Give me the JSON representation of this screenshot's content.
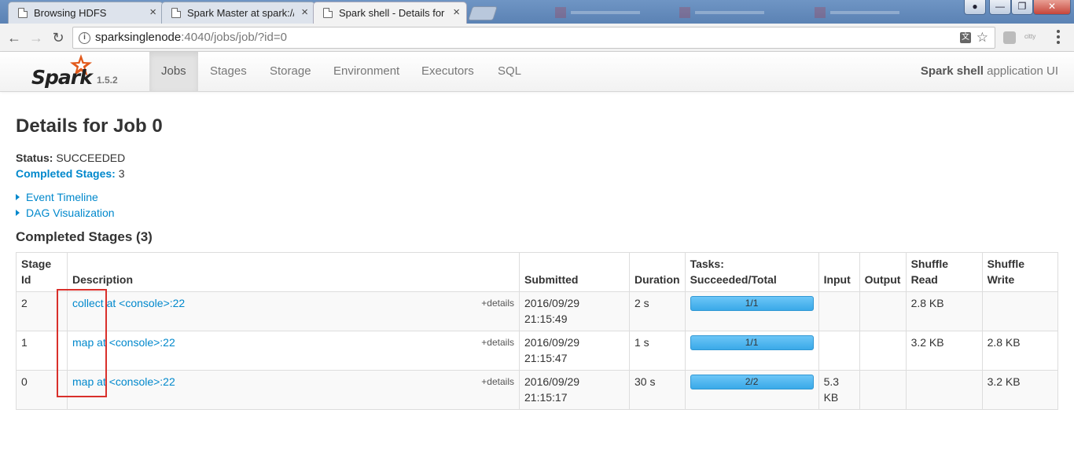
{
  "browser": {
    "tabs": [
      {
        "title": "Browsing HDFS"
      },
      {
        "title": "Spark Master at spark://"
      },
      {
        "title": "Spark shell - Details for"
      }
    ],
    "window_buttons": {
      "minimize": "—",
      "restore": "❐",
      "close": "✕"
    },
    "nav": {
      "back": "←",
      "forward": "→",
      "reload": "↻"
    },
    "url_host": "sparksinglenode",
    "url_path": ":4040/jobs/job/?id=0",
    "info_icon": "i",
    "translate_icon": "文",
    "star_icon": "☆",
    "ext_label": "citty"
  },
  "navbar": {
    "brand_word": "Spark",
    "version": "1.5.2",
    "tabs": [
      {
        "label": "Jobs",
        "active": true
      },
      {
        "label": "Stages"
      },
      {
        "label": "Storage"
      },
      {
        "label": "Environment"
      },
      {
        "label": "Executors"
      },
      {
        "label": "SQL"
      }
    ],
    "app_name": "Spark shell",
    "app_suffix": " application UI"
  },
  "job": {
    "title": "Details for Job 0",
    "status_label": "Status:",
    "status_value": "SUCCEEDED",
    "completed_stages_label": "Completed Stages:",
    "completed_stages_value": "3",
    "event_timeline": "Event Timeline",
    "dag_visualization": "DAG Visualization",
    "section_title": "Completed Stages (3)"
  },
  "table": {
    "headers": {
      "stage_id_1": "Stage",
      "stage_id_2": "Id",
      "description": "Description",
      "submitted": "Submitted",
      "duration": "Duration",
      "tasks_1": "Tasks:",
      "tasks_2": "Succeeded/Total",
      "input": "Input",
      "output": "Output",
      "shuffle_read_1": "Shuffle",
      "shuffle_read_2": "Read",
      "shuffle_write_1": "Shuffle",
      "shuffle_write_2": "Write"
    },
    "details_label": "+details",
    "rows": [
      {
        "id": "2",
        "desc": "collect at <console>:22",
        "date": "2016/09/29",
        "time": "21:15:49",
        "duration": "2 s",
        "tasks": "1/1",
        "progress": 1.0,
        "input_1": "",
        "input_2": "",
        "output": "",
        "shuffle_read": "2.8 KB",
        "shuffle_write": ""
      },
      {
        "id": "1",
        "desc": "map at <console>:22",
        "date": "2016/09/29",
        "time": "21:15:47",
        "duration": "1 s",
        "tasks": "1/1",
        "progress": 1.0,
        "input_1": "",
        "input_2": "",
        "output": "",
        "shuffle_read": "3.2 KB",
        "shuffle_write": "2.8 KB"
      },
      {
        "id": "0",
        "desc": "map at <console>:22",
        "date": "2016/09/29",
        "time": "21:15:17",
        "duration": "30 s",
        "tasks": "2/2",
        "progress": 1.0,
        "input_1": "5.3",
        "input_2": "KB",
        "output": "",
        "shuffle_read": "",
        "shuffle_write": "3.2 KB"
      }
    ]
  },
  "colors": {
    "link": "#0088cc",
    "progress": "#3aa9e8",
    "highlight": "#d9302b",
    "brand_star": "#e25a1c"
  }
}
